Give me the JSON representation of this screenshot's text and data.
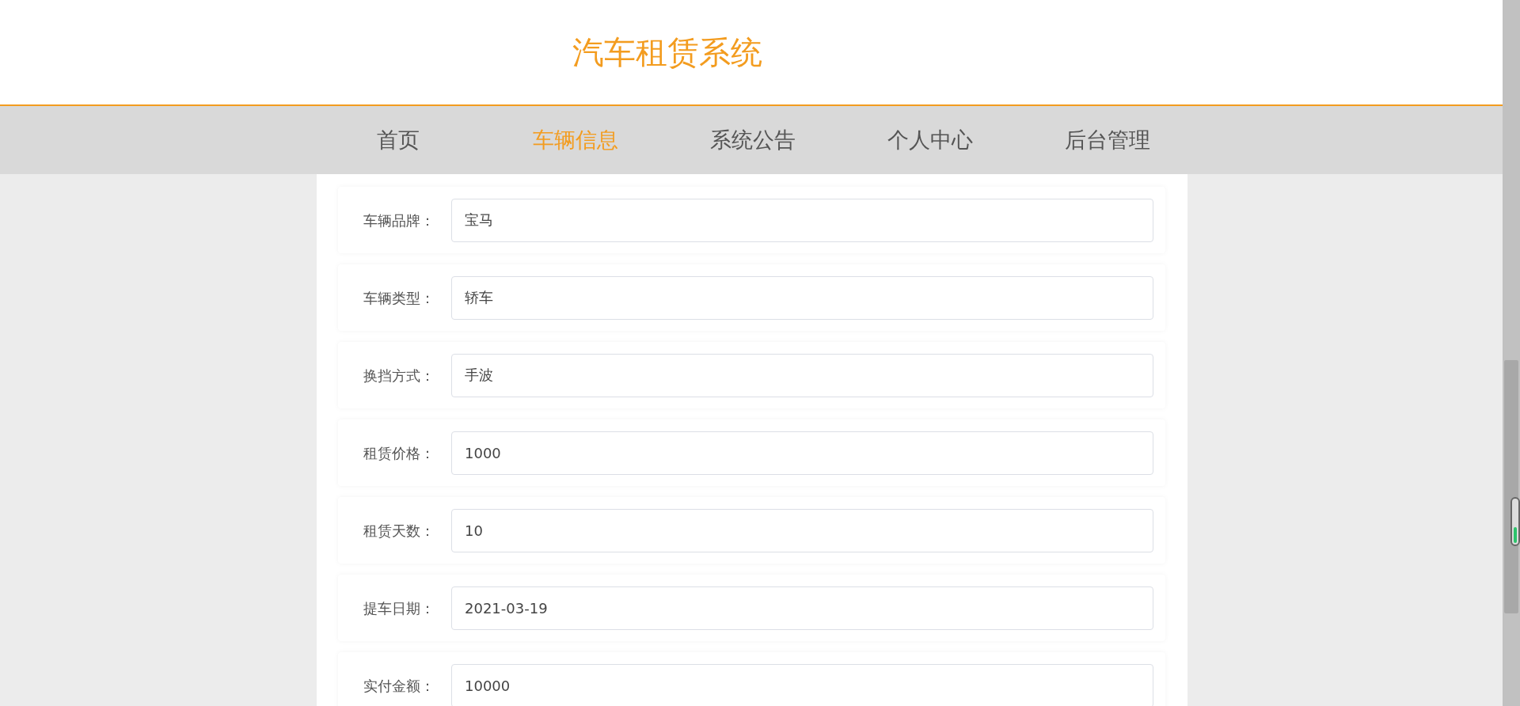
{
  "site_title": "汽车租赁系统",
  "nav": [
    {
      "label": "首页",
      "selected": false
    },
    {
      "label": "车辆信息",
      "selected": true
    },
    {
      "label": "系统公告",
      "selected": false
    },
    {
      "label": "个人中心",
      "selected": false
    },
    {
      "label": "后台管理",
      "selected": false
    }
  ],
  "form_fields": [
    {
      "label": "车辆品牌：",
      "value": "宝马"
    },
    {
      "label": "车辆类型：",
      "value": "轿车"
    },
    {
      "label": "换挡方式：",
      "value": "手波"
    },
    {
      "label": "租赁价格：",
      "value": "1000"
    },
    {
      "label": "租赁天数：",
      "value": "10"
    },
    {
      "label": "提车日期：",
      "value": "2021-03-19"
    },
    {
      "label": "实付金额：",
      "value": "10000"
    }
  ]
}
